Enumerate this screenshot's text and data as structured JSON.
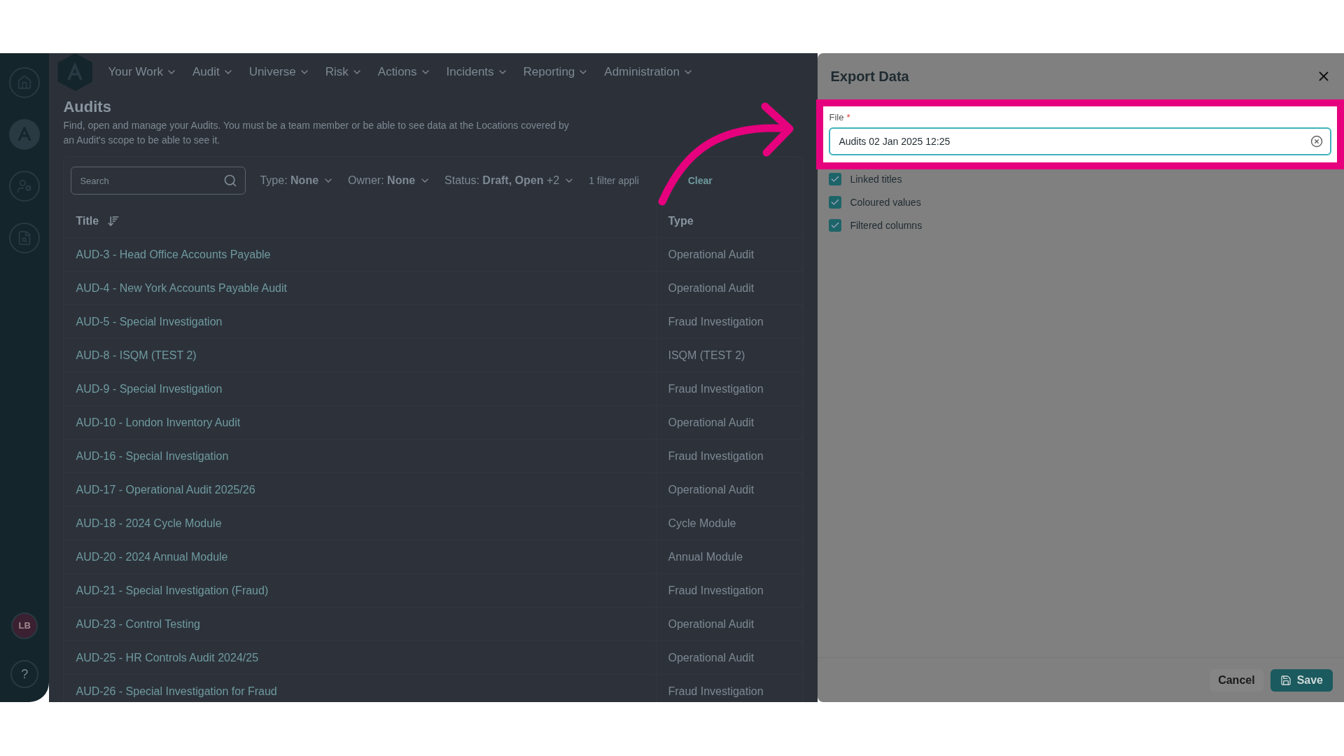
{
  "nav": {
    "menus": [
      "Your Work",
      "Audit",
      "Universe",
      "Risk",
      "Actions",
      "Incidents",
      "Reporting",
      "Administration"
    ]
  },
  "sidebar": {
    "avatar": "LB",
    "help": "?"
  },
  "page": {
    "title": "Audits",
    "description": "Find, open and manage your Audits. You must be a team member or be able to see data at the Locations covered by an Audit's scope to be able to see it."
  },
  "search": {
    "placeholder": "Search"
  },
  "filters": [
    {
      "label": "Type:",
      "value": "None"
    },
    {
      "label": "Owner:",
      "value": "None"
    },
    {
      "label": "Status:",
      "value": "Draft, Open",
      "extra": "+2"
    }
  ],
  "filter_note": "1 filter appli",
  "clear": "Clear",
  "table": {
    "columns": [
      "Title",
      "Type"
    ],
    "rows": [
      [
        "AUD-3 - Head Office Accounts Payable",
        "Operational Audit"
      ],
      [
        "AUD-4 - New York Accounts Payable Audit",
        "Operational Audit"
      ],
      [
        "AUD-5 - Special Investigation",
        "Fraud Investigation"
      ],
      [
        "AUD-8 - ISQM (TEST 2)",
        "ISQM (TEST 2)"
      ],
      [
        "AUD-9 - Special Investigation",
        "Fraud Investigation"
      ],
      [
        "AUD-10 - London Inventory Audit",
        "Operational Audit"
      ],
      [
        "AUD-16 - Special Investigation",
        "Fraud Investigation"
      ],
      [
        "AUD-17 - Operational Audit 2025/26",
        "Operational Audit"
      ],
      [
        "AUD-18 - 2024 Cycle Module",
        "Cycle Module"
      ],
      [
        "AUD-20 - 2024 Annual Module",
        "Annual Module"
      ],
      [
        "AUD-21 - Special Investigation (Fraud)",
        "Fraud Investigation"
      ],
      [
        "AUD-23 - Control Testing",
        "Operational Audit"
      ],
      [
        "AUD-25 - HR Controls Audit 2024/25",
        "Operational Audit"
      ],
      [
        "AUD-26 - Special Investigation for Fraud",
        "Fraud Investigation"
      ]
    ]
  },
  "export": {
    "title": "Export Data",
    "file_label": "File",
    "required": "*",
    "file_value": "Audits 02 Jan 2025 12:25",
    "options": [
      {
        "label": "Linked titles",
        "checked": true
      },
      {
        "label": "Coloured values",
        "checked": true
      },
      {
        "label": "Filtered columns",
        "checked": true
      }
    ],
    "cancel": "Cancel",
    "save": "Save"
  }
}
